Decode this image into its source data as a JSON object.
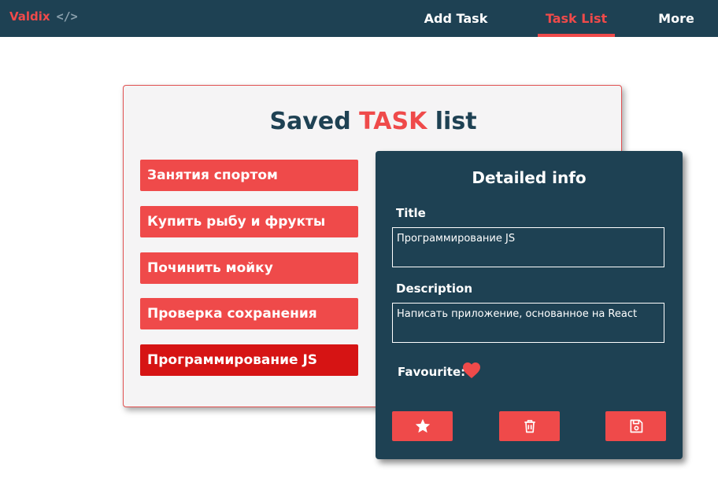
{
  "nav": {
    "brand": "Valdix",
    "brand_icon": "code-icon",
    "items": [
      {
        "label": "Add Task",
        "active": false
      },
      {
        "label": "Task List",
        "active": true
      },
      {
        "label": "More",
        "active": false
      }
    ]
  },
  "saved": {
    "title_prefix": "Saved ",
    "title_accent": "TASK",
    "title_suffix": " list",
    "tasks": [
      {
        "label": "Занятия спортом",
        "selected": false
      },
      {
        "label": "Купить рыбу и фрукты",
        "selected": false
      },
      {
        "label": "Починить мойку",
        "selected": false
      },
      {
        "label": "Проверка сохранения",
        "selected": false
      },
      {
        "label": "Программирование JS",
        "selected": true
      }
    ]
  },
  "detail": {
    "heading": "Detailed info",
    "title_label": "Title",
    "title_value": "Программирование JS",
    "description_label": "Description",
    "description_value": "Написать приложение, основанное на React",
    "favourite_label": "Favourite:",
    "favourite": true,
    "buttons": [
      "star-icon",
      "trash-icon",
      "save-icon"
    ]
  },
  "colors": {
    "nav_bg": "#1e4153",
    "accent": "#ef4a4a",
    "selected": "#d61414",
    "panel_bg": "#f5f4f5"
  }
}
